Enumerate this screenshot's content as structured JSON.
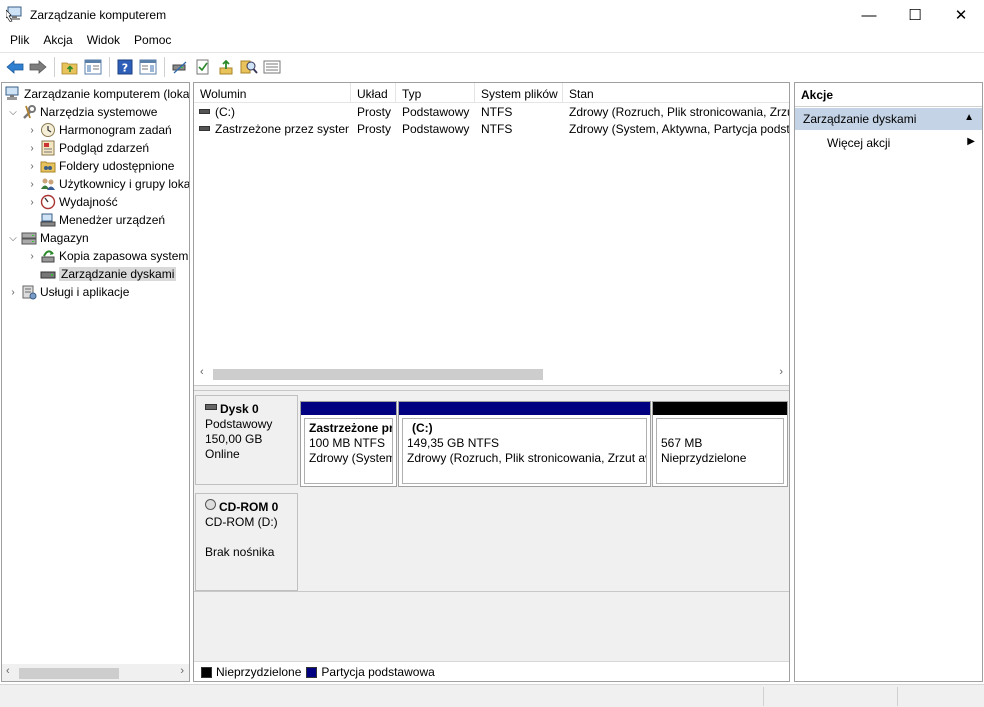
{
  "window": {
    "title": "Zarządzanie komputerem",
    "minimize": "—",
    "maximize": "☐",
    "close": "✕"
  },
  "menu": [
    "Plik",
    "Akcja",
    "Widok",
    "Pomoc"
  ],
  "toolbar": {
    "icons": [
      "back-arrow-icon",
      "forward-arrow-icon",
      "up-folder-icon",
      "show-hide-tree-icon",
      "help-icon",
      "properties-icon",
      "connect-icon",
      "check-icon",
      "import-icon",
      "search-disk-icon",
      "list-icon"
    ]
  },
  "tree": {
    "items": [
      {
        "label": "Zarządzanie komputerem (lokalne)",
        "icon": "computer-icon",
        "expander": ""
      },
      {
        "label": "Narzędzia systemowe",
        "icon": "tools-icon",
        "expander": "⌵"
      },
      {
        "label": "Harmonogram zadań",
        "icon": "clock-icon",
        "expander": "›"
      },
      {
        "label": "Podgląd zdarzeń",
        "icon": "event-viewer-icon",
        "expander": "›"
      },
      {
        "label": "Foldery udostępnione",
        "icon": "shared-folder-icon",
        "expander": "›"
      },
      {
        "label": "Użytkownicy i grupy lokalne",
        "icon": "users-icon",
        "expander": "›"
      },
      {
        "label": "Wydajność",
        "icon": "performance-icon",
        "expander": "›"
      },
      {
        "label": "Menedżer urządzeń",
        "icon": "device-manager-icon",
        "expander": ""
      },
      {
        "label": "Magazyn",
        "icon": "storage-icon",
        "expander": "⌵"
      },
      {
        "label": "Kopia zapasowa systemu Windows Server",
        "icon": "backup-icon",
        "expander": "›"
      },
      {
        "label": "Zarządzanie dyskami",
        "icon": "disk-management-icon",
        "expander": ""
      },
      {
        "label": "Usługi i aplikacje",
        "icon": "services-icon",
        "expander": "›"
      }
    ],
    "scroll_left": "‹",
    "scroll_right": "›"
  },
  "volumes": {
    "columns": [
      "Wolumin",
      "Układ",
      "Typ",
      "System plików",
      "Stan"
    ],
    "rows": [
      {
        "name": "(C:)",
        "layout": "Prosty",
        "type": "Podstawowy",
        "fs": "NTFS",
        "status": "Zdrowy (Rozruch, Plik stronicowania, Zrzut awaryjny, Partycja podstawowa)"
      },
      {
        "name": "Zastrzeżone przez system",
        "layout": "Prosty",
        "type": "Podstawowy",
        "fs": "NTFS",
        "status": "Zdrowy (System, Aktywna, Partycja podstawowa)"
      }
    ],
    "scroll_left": "‹",
    "scroll_right": "›"
  },
  "disks": [
    {
      "name": "Dysk 0",
      "type": "Podstawowy",
      "size": "150,00 GB",
      "status": "Online",
      "icon": "hard-disk-icon",
      "partitions": [
        {
          "name": "Zastrzeżone przez system",
          "size": "100 MB NTFS",
          "status": "Zdrowy (System, Aktywna, Partycja podstawowa)",
          "color": "#000080"
        },
        {
          "name": "(C:)",
          "size": "149,35 GB NTFS",
          "status": "Zdrowy (Rozruch, Plik stronicowania, Zrzut awaryjny, Partycja podstawowa)",
          "color": "#000080"
        },
        {
          "name": "",
          "size": "567 MB",
          "status": "Nieprzydzielone",
          "color": "#000000"
        }
      ]
    },
    {
      "name": "CD-ROM 0",
      "type": "CD-ROM (D:)",
      "status": "Brak nośnika",
      "icon": "cdrom-icon"
    }
  ],
  "legend": [
    {
      "label": "Nieprzydzielone",
      "color": "#000000"
    },
    {
      "label": "Partycja podstawowa",
      "color": "#000080"
    }
  ],
  "actions": {
    "title": "Akcje",
    "section": "Zarządzanie dyskami",
    "section_caret": "▲",
    "more": "Więcej akcji",
    "more_arrow": "▶"
  }
}
